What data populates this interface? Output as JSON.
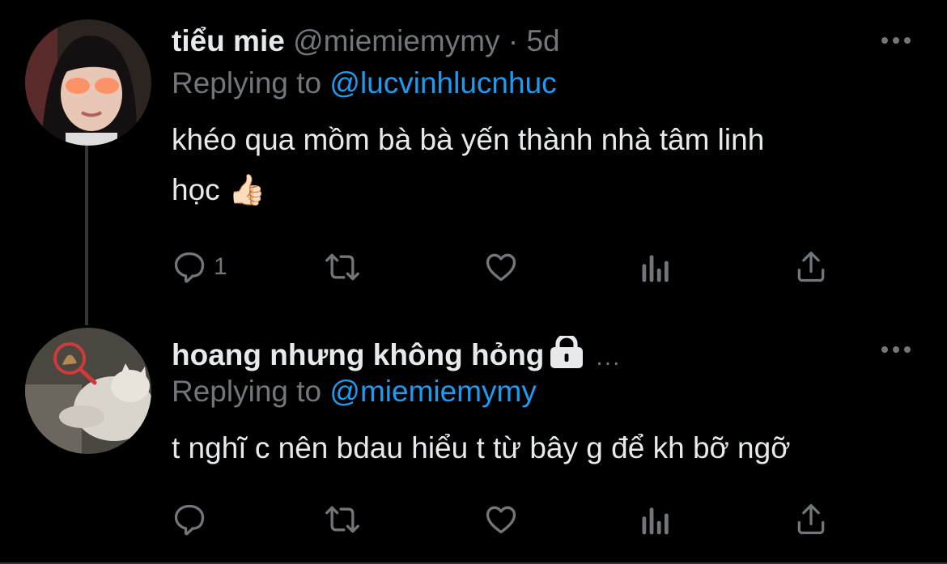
{
  "colors": {
    "background": "#000000",
    "text": "#e7e9ea",
    "muted": "#71767b",
    "link": "#1d9bf0"
  },
  "tweets": [
    {
      "name": "tiểu mie",
      "handle": "@miemiemymy",
      "dot": "·",
      "time": "5d",
      "replying_prefix": "Replying to ",
      "replying_to": "@lucvinhlucnhuc",
      "text_line1": "khéo qua mồm bà bà yến thành nhà tâm linh",
      "text_line2": "học",
      "emoji": "👍🏻",
      "reply_count": "1"
    },
    {
      "name": "hoang nhưng không hỏng",
      "trail": "...",
      "replying_prefix": "Replying to ",
      "replying_to": "@miemiemymy",
      "text_line1": "t nghĩ c nên bdau hiểu t từ bây g để kh bỡ ngỡ",
      "reply_count": ""
    }
  ],
  "icons": [
    "more-icon",
    "reply-icon",
    "retweet-icon",
    "like-icon",
    "stats-icon",
    "share-icon",
    "lock-icon"
  ]
}
